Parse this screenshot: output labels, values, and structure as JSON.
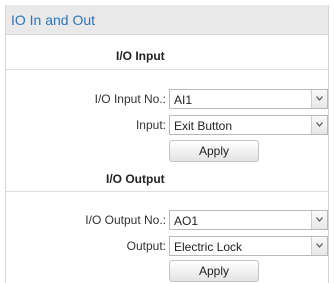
{
  "header": {
    "title": "IO In and Out"
  },
  "io_input": {
    "section_title": "I/O Input",
    "input_no_label": "I/O Input No.:",
    "input_no_value": "AI1",
    "input_label": "Input:",
    "input_value": "Exit Button",
    "apply_label": "Apply"
  },
  "io_output": {
    "section_title": "I/O Output",
    "output_no_label": "I/O Output No.:",
    "output_no_value": "AO1",
    "output_label": "Output:",
    "output_value": "Electric Lock",
    "apply_label": "Apply"
  },
  "icons": {
    "dropdown_arrow": "chevron-down-icon"
  }
}
